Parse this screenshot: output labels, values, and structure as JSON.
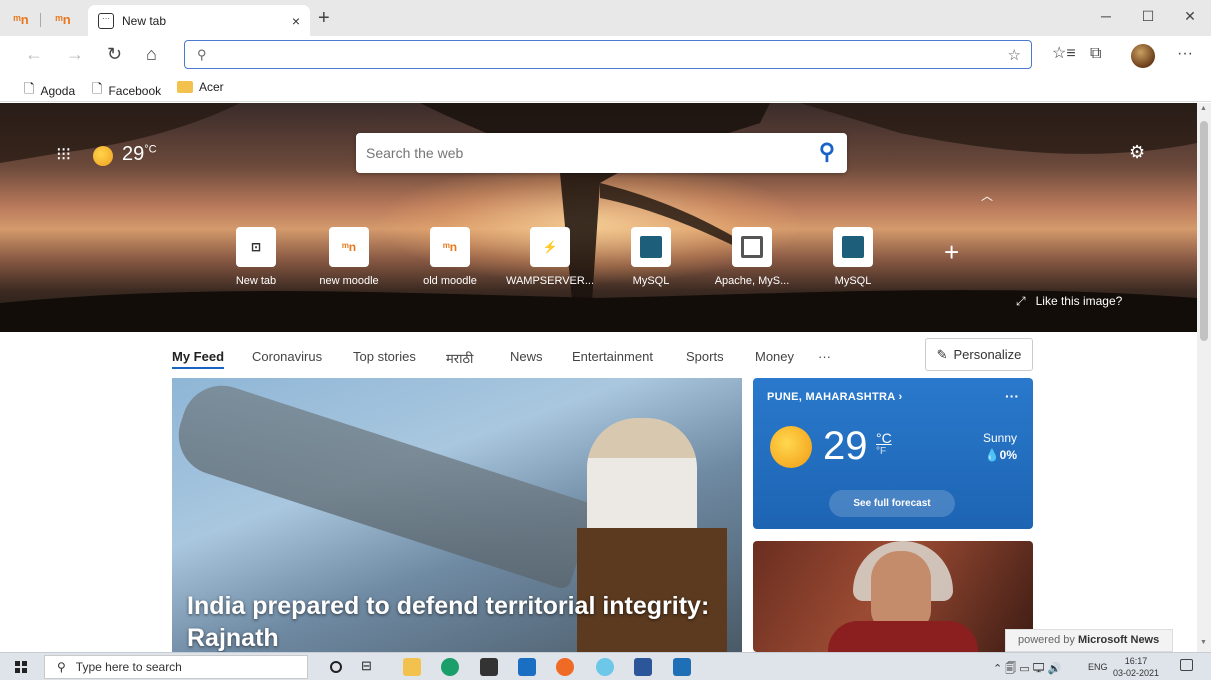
{
  "browser": {
    "tab_title": "New tab",
    "tab_close": "×",
    "new_tab_symbol": "+",
    "pinned_tabs": [
      "moodle-favicon",
      "moodle-favicon"
    ],
    "window_controls": {
      "minimize": "─",
      "maximize": "☐",
      "close": "✕"
    },
    "nav": {
      "back": "←",
      "forward": "→",
      "refresh": "↻",
      "home": "⌂"
    },
    "address_placeholder": "",
    "address_value": "",
    "toolbar": {
      "favorites_icon": "☆",
      "collections_icon": "⧉",
      "more": "···"
    },
    "bookmarks": [
      {
        "label": "Agoda",
        "icon": "page-icon"
      },
      {
        "label": "Facebook",
        "icon": "page-icon"
      },
      {
        "label": "Acer",
        "icon": "folder-icon"
      }
    ]
  },
  "hero": {
    "temperature": "29",
    "temperature_unit": "°C",
    "search_placeholder": "Search the web",
    "like_image": "Like this image?",
    "quick_links": [
      {
        "label": "New tab"
      },
      {
        "label": "new moodle"
      },
      {
        "label": "old moodle"
      },
      {
        "label": "WAMPSERVER..."
      },
      {
        "label": "MySQL"
      },
      {
        "label": "Apache, MyS..."
      },
      {
        "label": "MySQL"
      }
    ]
  },
  "feed": {
    "tabs": [
      "My Feed",
      "Coronavirus",
      "Top stories",
      "मराठी",
      "News",
      "Entertainment",
      "Sports",
      "Money",
      "···"
    ],
    "personalize": "Personalize",
    "main_headline": "India prepared to defend territorial integrity: Rajnath",
    "weather": {
      "location": "PUNE, MAHARASHTRA",
      "more": "···",
      "temp": "29",
      "unit_c": "°C",
      "unit_f": "°F",
      "condition": "Sunny",
      "precip": "0%",
      "forecast_button": "See full forecast"
    },
    "powered_by_prefix": "powered by ",
    "powered_by_brand": "Microsoft News"
  },
  "taskbar": {
    "search_placeholder": "Type here to search",
    "language": "ENG",
    "time": "16:17",
    "date": "03-02-2021"
  },
  "colors": {
    "accent": "#1a63c6",
    "weather_card": "#2a79cc",
    "taskbar": "#dfe4ea"
  }
}
